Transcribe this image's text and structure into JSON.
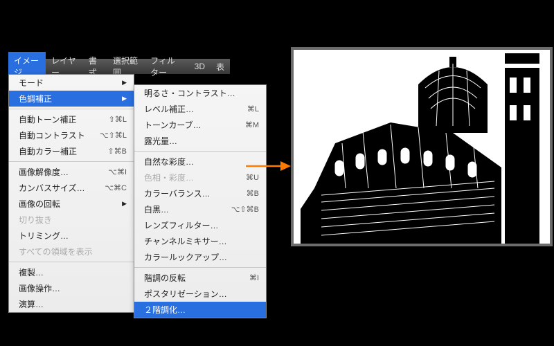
{
  "menubar": {
    "items": [
      "イメージ",
      "レイヤー",
      "書式",
      "選択範囲",
      "フィルター",
      "3D",
      "表"
    ],
    "active_index": 0
  },
  "menu_left": {
    "items": [
      {
        "label": "モード",
        "arrow": true
      },
      {
        "label": "色調補正",
        "arrow": true,
        "selected": true
      },
      {
        "sep": true
      },
      {
        "label": "自動トーン補正",
        "shortcut": "⇧⌘L"
      },
      {
        "label": "自動コントラスト",
        "shortcut": "⌥⇧⌘L"
      },
      {
        "label": "自動カラー補正",
        "shortcut": "⇧⌘B"
      },
      {
        "sep": true
      },
      {
        "label": "画像解像度…",
        "shortcut": "⌥⌘I"
      },
      {
        "label": "カンバスサイズ…",
        "shortcut": "⌥⌘C"
      },
      {
        "label": "画像の回転",
        "arrow": true
      },
      {
        "label": "切り抜き",
        "disabled": true
      },
      {
        "label": "トリミング…"
      },
      {
        "label": "すべての領域を表示",
        "disabled": true
      },
      {
        "sep": true
      },
      {
        "label": "複製…"
      },
      {
        "label": "画像操作…"
      },
      {
        "label": "演算…"
      }
    ]
  },
  "menu_right": {
    "items": [
      {
        "label": "明るさ・コントラスト…"
      },
      {
        "label": "レベル補正…",
        "shortcut": "⌘L"
      },
      {
        "label": "トーンカーブ…",
        "shortcut": "⌘M"
      },
      {
        "label": "露光量…"
      },
      {
        "sep": true
      },
      {
        "label": "自然な彩度…"
      },
      {
        "label": "色相・彩度…",
        "shortcut": "⌘U",
        "disabled": true
      },
      {
        "label": "カラーバランス…",
        "shortcut": "⌘B"
      },
      {
        "label": "白黒…",
        "shortcut": "⌥⇧⌘B"
      },
      {
        "label": "レンズフィルター…"
      },
      {
        "label": "チャンネルミキサー…"
      },
      {
        "label": "カラールックアップ…"
      },
      {
        "sep": true
      },
      {
        "label": "階調の反転",
        "shortcut": "⌘I"
      },
      {
        "label": "ポスタリゼーション…"
      },
      {
        "label": "２階調化…",
        "selected": true
      }
    ]
  },
  "arrow_color": "#ff7a00",
  "image_alt": "threshold-processed building sketch"
}
